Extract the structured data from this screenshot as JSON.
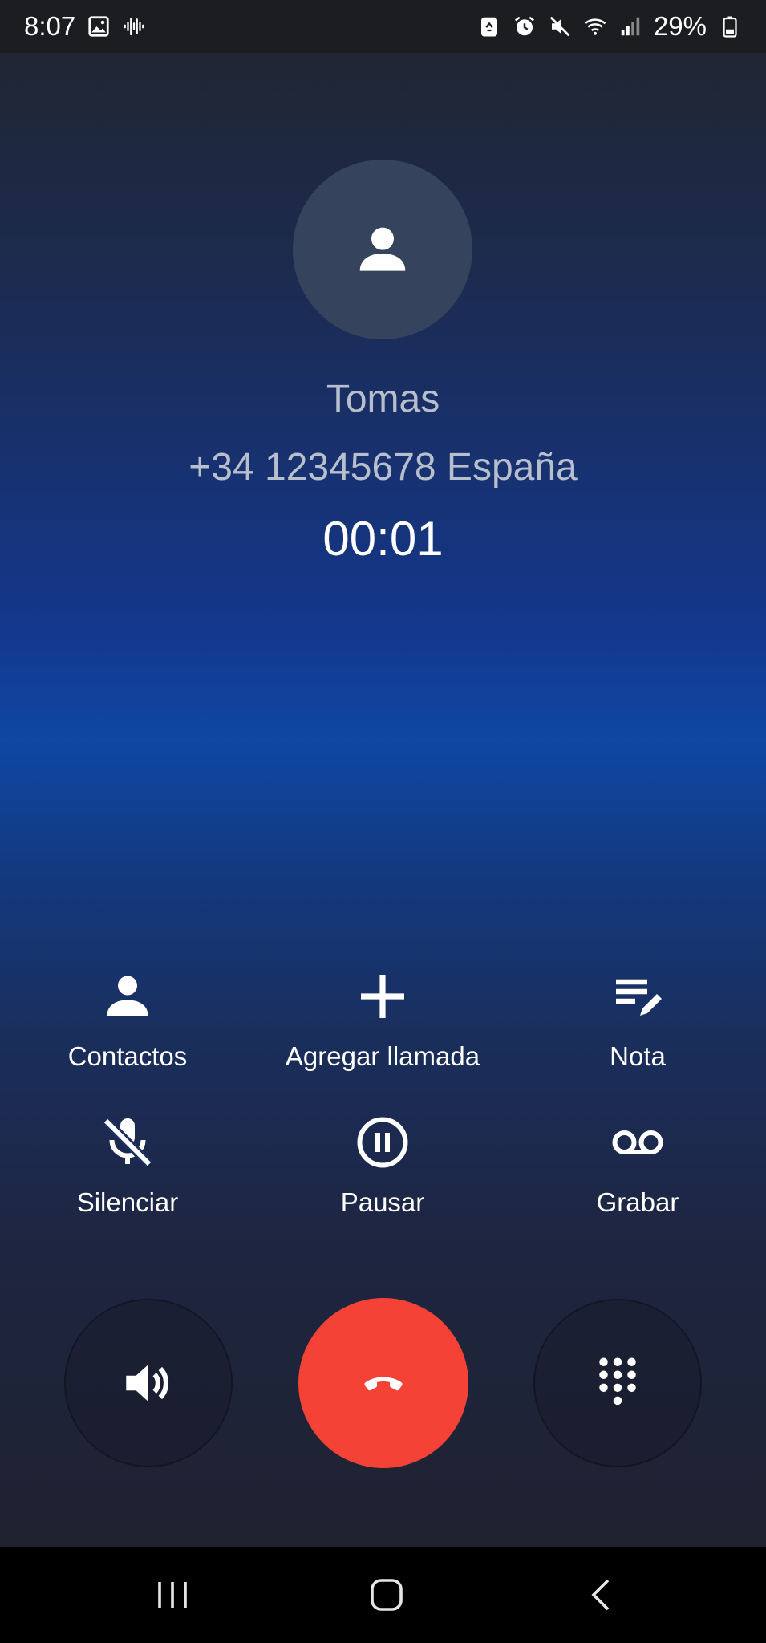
{
  "status_bar": {
    "time": "8:07",
    "battery": "29%",
    "left_icons": [
      "image-icon",
      "voice-wave-icon"
    ],
    "right_icons": [
      "recycle-icon",
      "alarm-icon",
      "mute-icon",
      "wifi-icon",
      "signal-icon",
      "battery-icon"
    ]
  },
  "caller": {
    "name": "Tomas",
    "number": "+34 12345678 España",
    "duration": "00:01"
  },
  "actions": [
    {
      "label": "Contactos",
      "icon": "person-icon"
    },
    {
      "label": "Agregar llamada",
      "icon": "add-icon"
    },
    {
      "label": "Nota",
      "icon": "note-edit-icon"
    },
    {
      "label": "Silenciar",
      "icon": "mic-off-icon"
    },
    {
      "label": "Pausar",
      "icon": "pause-icon"
    },
    {
      "label": "Grabar",
      "icon": "voicemail-icon"
    }
  ],
  "controls": {
    "speaker_icon": "speaker-icon",
    "end_call_icon": "end-call-icon",
    "keypad_icon": "dialpad-icon",
    "end_call_color": "#f44336"
  },
  "nav_bar": {
    "icons": [
      "recent-apps-icon",
      "home-icon",
      "back-icon"
    ]
  },
  "colors": {
    "status_bar_bg": "#1c1d21",
    "gradient_mid": "#0e47a4",
    "caller_text": "#b8bfcc",
    "avatar_bg": "#35435d"
  }
}
